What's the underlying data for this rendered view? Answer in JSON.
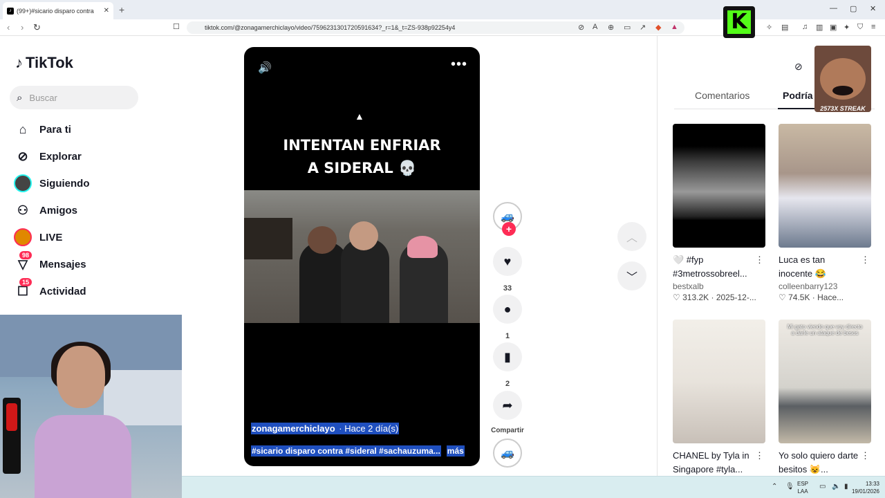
{
  "browser": {
    "tab_title": "(99+)#sicario disparo contra",
    "tab_close": "✕",
    "new_tab": "+",
    "url": "tiktok.com/@zonagamerchiclayo/video/7596231301720591634?_r=1&_t=ZS-938p92254y4"
  },
  "sidebar": {
    "logo_text": "TikTok",
    "search_placeholder": "Buscar",
    "items": [
      {
        "label": "Para ti",
        "icon": "home-icon"
      },
      {
        "label": "Explorar",
        "icon": "compass-icon"
      },
      {
        "label": "Siguiendo",
        "icon": "avatar"
      },
      {
        "label": "Amigos",
        "icon": "friends-icon"
      },
      {
        "label": "LIVE",
        "icon": "live-avatar"
      },
      {
        "label": "Mensajes",
        "icon": "send-icon",
        "badge": "98"
      },
      {
        "label": "Actividad",
        "icon": "activity-icon",
        "badge": "15"
      }
    ]
  },
  "video": {
    "caption_line1": "INTENTAN ENFRIAR",
    "caption_line2": "A SIDERAL 💀",
    "author": "zonagamerchiclayo",
    "time": " · Hace 2 día(s)",
    "tags": "#sicario disparo contra #sideral #sachauzuma...",
    "more_label": "más"
  },
  "actions": {
    "likes": "33",
    "comments": "1",
    "saves": "2",
    "share_label": "Compartir"
  },
  "right_panel": {
    "tabs": [
      "Comentarios",
      "Podría i"
    ],
    "streamer_label": "2573X STREAK",
    "cards": [
      {
        "title": "🤍 #fyp #3metrossobreel...",
        "author": "bestxalb",
        "likes": "313.2K",
        "date": "2025-12-..."
      },
      {
        "title": "Luca es tan inocente 😂",
        "author": "colleenbarry123",
        "likes": "74.5K",
        "date": "Hace..."
      },
      {
        "title": "CHANEL by Tyla in Singapore #tyla...",
        "author": "",
        "likes": "",
        "date": ""
      },
      {
        "title": "Yo solo quiero darte besitos 😺...",
        "author": "",
        "likes": "",
        "date": "",
        "thumb_text": "Mi gato viendo que voy directo a darle un ataque de besos"
      }
    ]
  },
  "taskbar": {
    "lang_line1": "ESP",
    "lang_line2": "LAA",
    "time": "13:33",
    "date": "19/01/2026"
  },
  "colors": {
    "accent": "#fe2c55",
    "highlight": "#1f4fbf",
    "kick_green": "#53fc18"
  }
}
